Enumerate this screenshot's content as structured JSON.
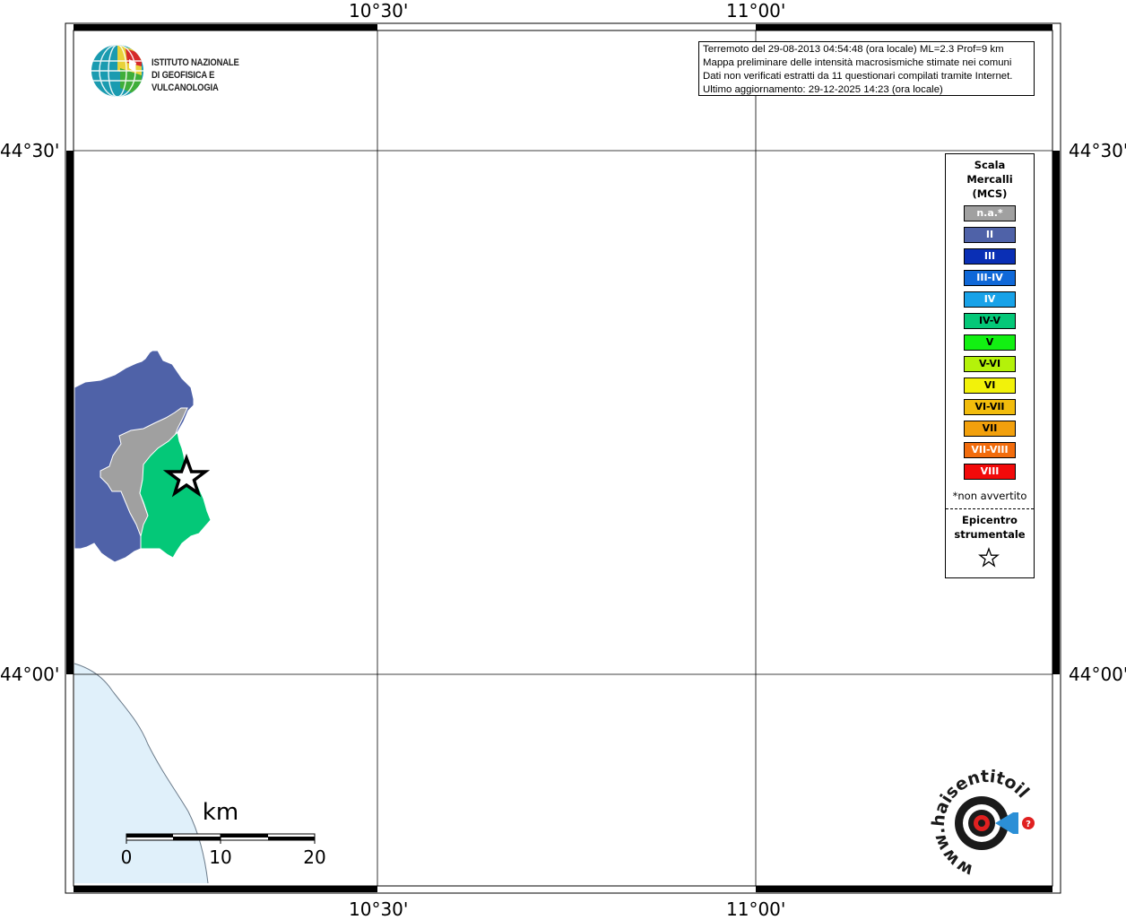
{
  "info": {
    "line1": "Terremoto del 29-08-2013 04:54:48 (ora locale) ML=2.3 Prof=9 km",
    "line2": "Mappa preliminare delle intensità macrosismiche stimate nei comuni",
    "line3": "Dati non verificati estratti da 11 questionari compilati tramite Internet.",
    "line4": "Ultimo aggiornamento: 29-12-2025 14:23 (ora locale)"
  },
  "logo_ingv": {
    "line1": "ISTITUTO NAZIONALE",
    "line2": "DI GEOFISICA E VULCANOLOGIA"
  },
  "logo_hsit": {
    "text": "www.haisentitoilterremoto.it"
  },
  "axes": {
    "top": [
      "10°30'",
      "11°00'"
    ],
    "bottom": [
      "10°30'",
      "11°00'"
    ],
    "left": [
      "44°30'",
      "44°00'"
    ],
    "right": [
      "44°30'",
      "44°00'"
    ]
  },
  "legend": {
    "title": [
      "Scala",
      "Mercalli",
      "(MCS)"
    ],
    "items": [
      {
        "label": "n.a.*",
        "color": "#a0a0a0",
        "text_color": "#ffffff"
      },
      {
        "label": "II",
        "color": "#4f62a8",
        "text_color": "#ffffff"
      },
      {
        "label": "III",
        "color": "#0a2fb5",
        "text_color": "#ffffff"
      },
      {
        "label": "III-IV",
        "color": "#0f68d8",
        "text_color": "#ffffff"
      },
      {
        "label": "IV",
        "color": "#18a2e8",
        "text_color": "#ffffff"
      },
      {
        "label": "IV-V",
        "color": "#04c878",
        "text_color": "#000000"
      },
      {
        "label": "V",
        "color": "#12f012",
        "text_color": "#000000"
      },
      {
        "label": "V-VI",
        "color": "#b4f20a",
        "text_color": "#000000"
      },
      {
        "label": "VI",
        "color": "#f2f20a",
        "text_color": "#000000"
      },
      {
        "label": "VI-VII",
        "color": "#f2bc0c",
        "text_color": "#000000"
      },
      {
        "label": "VII",
        "color": "#f2a00c",
        "text_color": "#000000"
      },
      {
        "label": "VII-VIII",
        "color": "#f26c0c",
        "text_color": "#ffffff"
      },
      {
        "label": "VIII",
        "color": "#f20a0a",
        "text_color": "#ffffff"
      }
    ],
    "note": "*non avvertito",
    "epicenter_title": [
      "Epicentro",
      "strumentale"
    ]
  },
  "scalebar": {
    "unit": "km",
    "ticks": [
      "0",
      "10",
      "20"
    ]
  },
  "regions": {
    "II_color": "#4f62a8",
    "na_color": "#a0a0a0",
    "IVV_color": "#04c878",
    "sea_color": "#e0f0fa"
  }
}
